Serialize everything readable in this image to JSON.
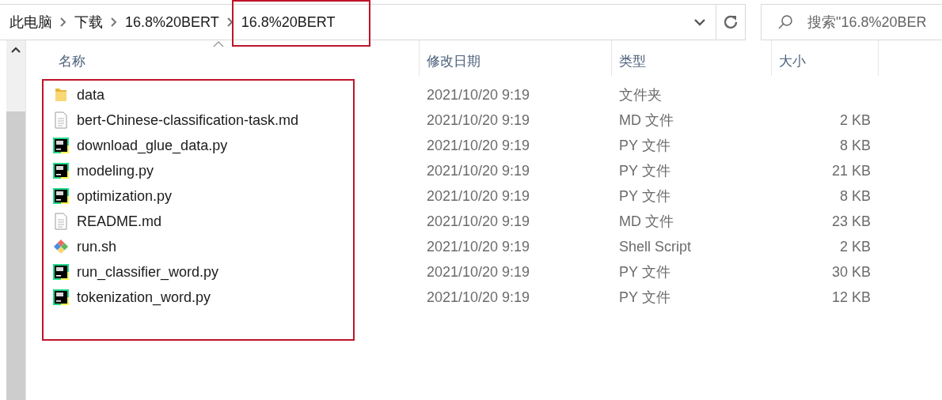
{
  "breadcrumb": [
    "此电脑",
    "下载",
    "16.8%20BERT",
    "16.8%20BERT"
  ],
  "search": {
    "placeholder": "搜索\"16.8%20BER"
  },
  "columns": [
    {
      "label": "名称",
      "sorted": true
    },
    {
      "label": "修改日期",
      "sorted": false
    },
    {
      "label": "类型",
      "sorted": false
    },
    {
      "label": "大小",
      "sorted": false
    }
  ],
  "files": [
    {
      "kind": "folder",
      "name": "data",
      "modified": "2021/10/20 9:19",
      "type": "文件夹"
    },
    {
      "kind": "text",
      "name": "bert-Chinese-classification-task.md",
      "modified": "2021/10/20 9:19",
      "type": "MD 文件",
      "size": "2 KB"
    },
    {
      "kind": "python",
      "name": "download_glue_data.py",
      "modified": "2021/10/20 9:19",
      "type": "PY 文件",
      "size": "8 KB"
    },
    {
      "kind": "python",
      "name": "modeling.py",
      "modified": "2021/10/20 9:19",
      "type": "PY 文件",
      "size": "21 KB"
    },
    {
      "kind": "python",
      "name": "optimization.py",
      "modified": "2021/10/20 9:19",
      "type": "PY 文件",
      "size": "8 KB"
    },
    {
      "kind": "text",
      "name": "README.md",
      "modified": "2021/10/20 9:19",
      "type": "MD 文件",
      "size": "23 KB"
    },
    {
      "kind": "shell",
      "name": "run.sh",
      "modified": "2021/10/20 9:19",
      "type": "Shell Script",
      "size": "2 KB"
    },
    {
      "kind": "python",
      "name": "run_classifier_word.py",
      "modified": "2021/10/20 9:19",
      "type": "PY 文件",
      "size": "30 KB"
    },
    {
      "kind": "python",
      "name": "tokenization_word.py",
      "modified": "2021/10/20 9:19",
      "type": "PY 文件",
      "size": "12 KB"
    }
  ]
}
